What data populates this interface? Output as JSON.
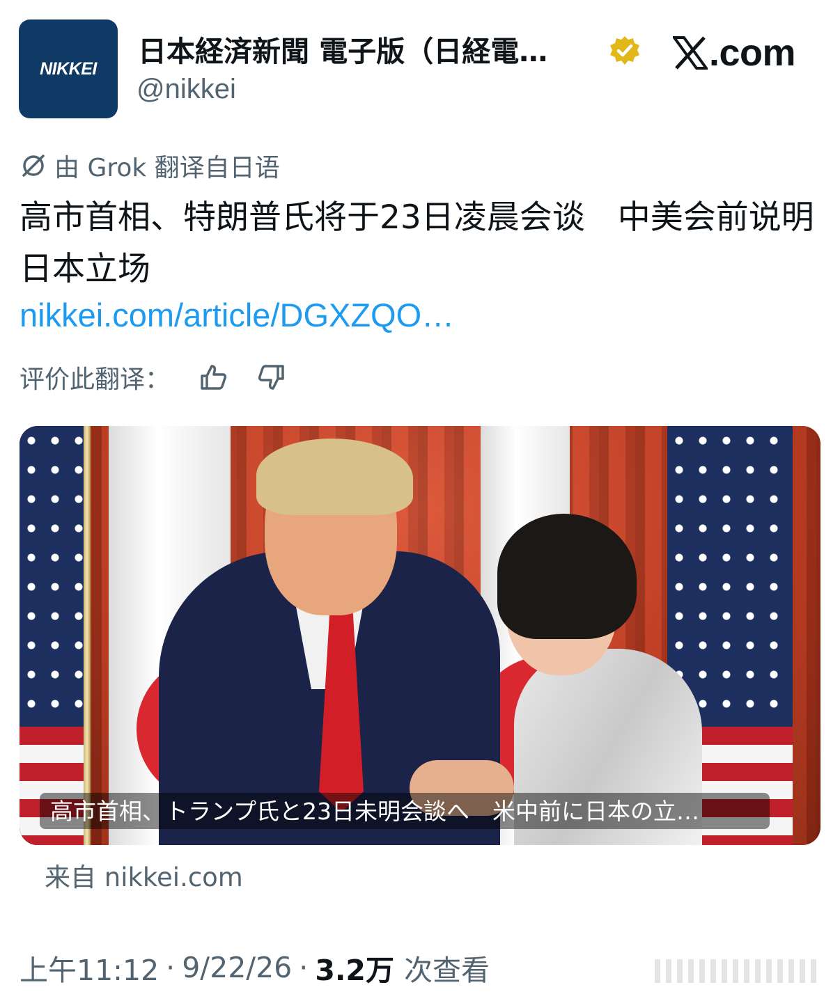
{
  "account": {
    "avatar_text": "NIKKEI",
    "display_name": "日本経済新聞 電子版（日経電…",
    "handle": "@nikkei",
    "verified_icon": "gold-verified-badge"
  },
  "brand": {
    "dotcom": ".com"
  },
  "translation": {
    "note": "由 Grok 翻译自日语",
    "icon": "no-translate-icon"
  },
  "tweet": {
    "text": "高市首相、特朗普氏将于23日凌晨会谈　中美会前说明日本立场",
    "link": "nikkei.com/article/DGXZQO…"
  },
  "rating": {
    "label": "评价此翻译：",
    "thumbs_up_icon": "thumbs-up-icon",
    "thumbs_down_icon": "thumbs-down-icon"
  },
  "card": {
    "caption": "高市首相、トランプ氏と23日未明会談へ　米中前に日本の立…",
    "source": "来自 nikkei.com"
  },
  "meta": {
    "time": "上午11:12",
    "date": "9/22/26",
    "views_count": "3.2万",
    "views_label": "次查看",
    "separator": "·"
  },
  "colors": {
    "avatar_bg": "#0f3a66",
    "link": "#1d9bf0",
    "muted": "#536471",
    "verified": "#e2b719"
  }
}
